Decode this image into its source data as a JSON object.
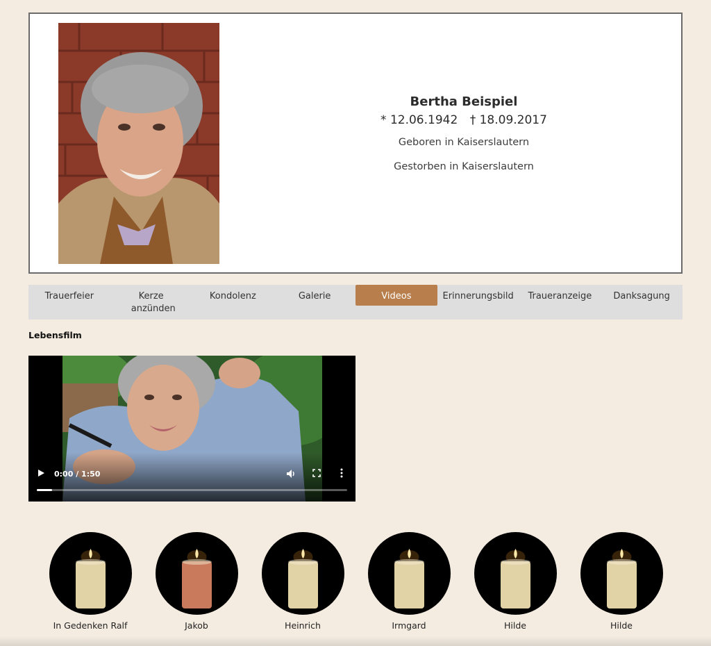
{
  "profile": {
    "name": "Bertha Beispiel",
    "birth": "* 12.06.1942",
    "death": "† 18.09.2017",
    "born_in": "Geboren in Kaiserslautern",
    "died_in": "Gestorben in Kaiserslautern"
  },
  "tabs": [
    {
      "label": "Trauerfeier",
      "active": false
    },
    {
      "label": "Kerze anzünden",
      "active": false
    },
    {
      "label": "Kondolenz",
      "active": false
    },
    {
      "label": "Galerie",
      "active": false
    },
    {
      "label": "Videos",
      "active": true
    },
    {
      "label": "Erinnerungsbild",
      "active": false
    },
    {
      "label": "Traueranzeige",
      "active": false
    },
    {
      "label": "Danksagung",
      "active": false
    }
  ],
  "section_title": "Lebensfilm",
  "video": {
    "time": "0:00 / 1:50",
    "progress": 0.05
  },
  "candles": [
    {
      "name": "In Gedenken Ralf",
      "color": "#e2d3a6"
    },
    {
      "name": "Jakob",
      "color": "#c97a5c"
    },
    {
      "name": "Heinrich",
      "color": "#e2d3a6"
    },
    {
      "name": "Irmgard",
      "color": "#e2d3a6"
    },
    {
      "name": "Hilde",
      "color": "#e2d3a6"
    },
    {
      "name": "Hilde",
      "color": "#e2d3a6"
    }
  ],
  "colors": {
    "accent": "#b87e4b",
    "background": "#f5ece1"
  }
}
